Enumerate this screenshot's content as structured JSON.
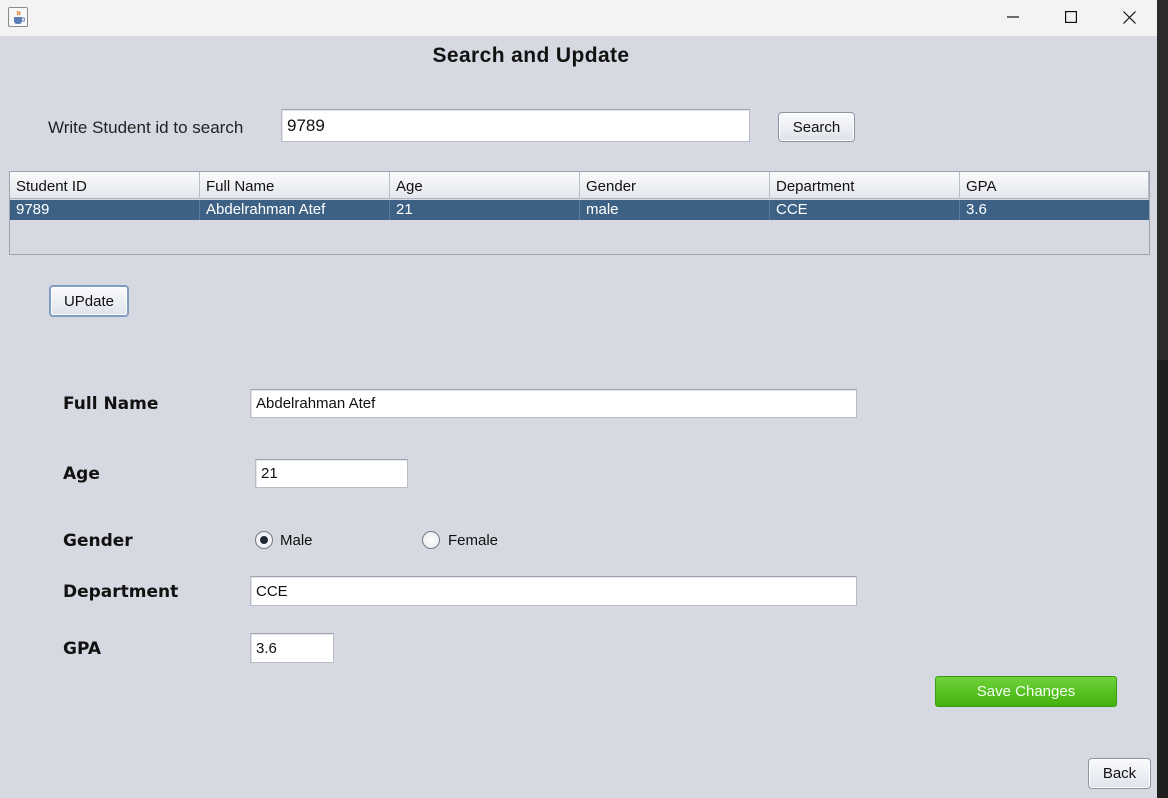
{
  "window": {
    "icons": {
      "app": "java-cup-icon",
      "minimize": "minimize-icon",
      "maximize": "maximize-icon",
      "close": "close-icon"
    }
  },
  "form": {
    "title": "Search and Update",
    "search": {
      "label": "Write Student id to search",
      "value": "9789",
      "button": "Search"
    },
    "table": {
      "columns": [
        "Student ID",
        "Full Name",
        "Age",
        "Gender",
        "Department",
        "GPA"
      ],
      "rows": [
        [
          "9789",
          "Abdelrahman Atef",
          "21",
          "male",
          "CCE",
          "3.6"
        ]
      ],
      "selected_row": 0
    },
    "update_button": "UPdate",
    "fields": {
      "full_name": {
        "label": "Full Name",
        "value": "Abdelrahman Atef"
      },
      "age": {
        "label": "Age",
        "value": "21"
      },
      "gender": {
        "label": "Gender",
        "options": [
          "Male",
          "Female"
        ],
        "selected": "Male"
      },
      "department": {
        "label": "Department",
        "value": "CCE"
      },
      "gpa": {
        "label": "GPA",
        "value": "3.6"
      }
    },
    "save_button": "Save Changes",
    "back_button": "Back"
  },
  "colors": {
    "background": "#d6d9e1",
    "selection": "#3d6185",
    "save_button": "#4cbd18"
  }
}
